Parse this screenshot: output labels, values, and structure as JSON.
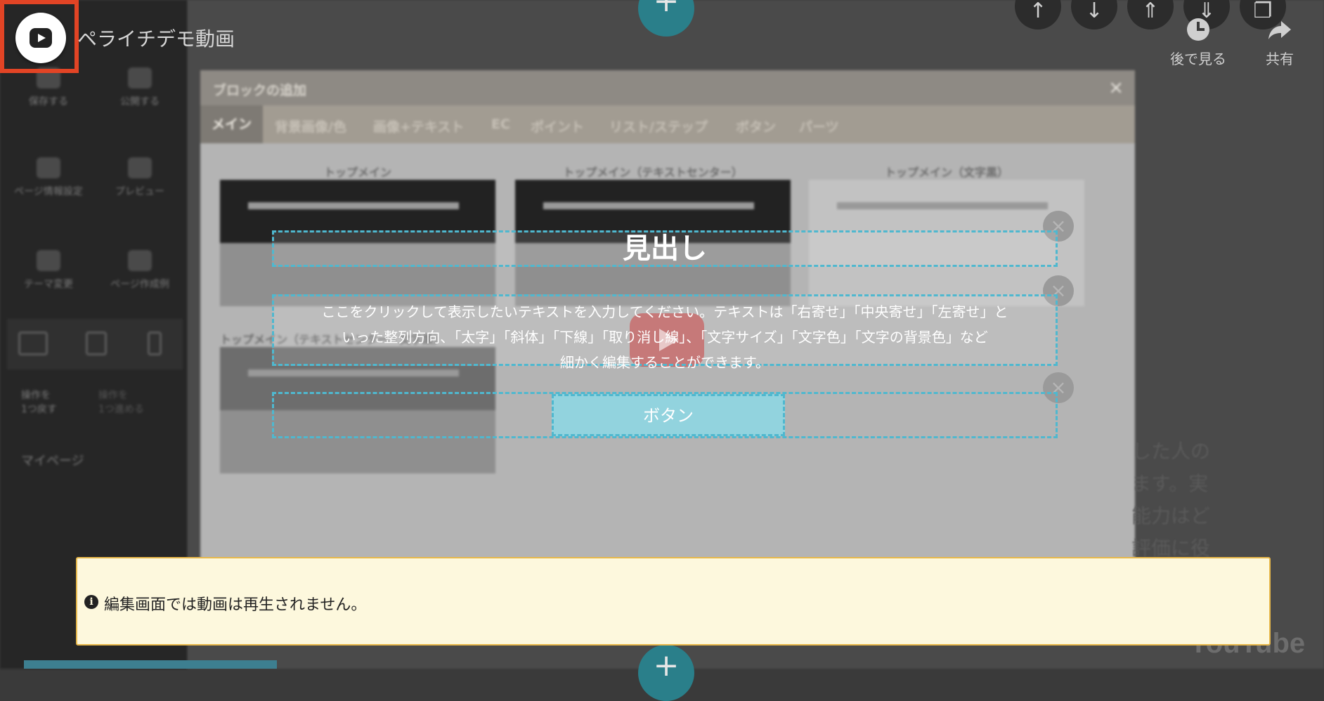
{
  "video": {
    "title": "ペライチデモ動画",
    "actions": [
      {
        "label": "後で見る",
        "icon": "clock-icon"
      },
      {
        "label": "共有",
        "icon": "share-icon"
      }
    ],
    "logo_text": "YouTube"
  },
  "sidebar": {
    "items": [
      {
        "label": "保存する",
        "icon": "save-icon"
      },
      {
        "label": "公開する",
        "icon": "publish-icon"
      },
      {
        "label": "ページ情報設定",
        "icon": "gear-icon"
      },
      {
        "label": "プレビュー",
        "icon": "preview-icon"
      },
      {
        "label": "テーマ変更",
        "icon": "palette-icon"
      },
      {
        "label": "ページ作成例",
        "icon": "template-icon"
      }
    ],
    "undo_label": "操作を\n1つ戻す",
    "redo_label": "操作を\n1つ進める",
    "mypage_label": "マイページ"
  },
  "modal": {
    "title": "ブロックの追加",
    "close_label": "×",
    "tabs": [
      "メイン",
      "背景画像/色",
      "画像+テキスト",
      "EC",
      "ポイント",
      "リスト/ステップ",
      "ボタン",
      "パーツ"
    ],
    "templates": [
      "トップメイン",
      "トップメイン（テキストセンター）",
      "トップメイン（文字黒）",
      "トップメイン（テキストセンター・文字黒）"
    ]
  },
  "block": {
    "headline": "見出し",
    "body_lines": [
      "ここをクリックして表示したいテキストを入力してください。テキストは「右寄せ」「中央寄せ」「左寄せ」と",
      "いった整列方向、「太字」「斜体」「下線」「取り消し線」、「文字サイズ」「文字色」「文字の背景色」など",
      "細かく編集することができます。"
    ],
    "button_label": "ボタン"
  },
  "right_text": [
    "した人の",
    "ます。実",
    "能力はど",
    "評価に役"
  ],
  "notice": {
    "icon": "info-icon",
    "text": "編集画面では動画は再生されません。"
  }
}
